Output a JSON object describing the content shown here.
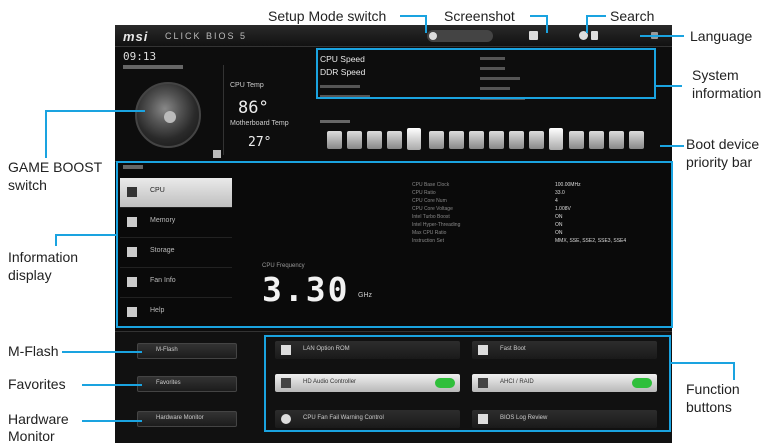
{
  "callouts": {
    "setup_mode_switch": "Setup Mode switch",
    "screenshot": "Screenshot",
    "search": "Search",
    "language": "Language",
    "system_information_line1": "System",
    "system_information_line2": "information",
    "game_boost_line1": "GAME BOOST",
    "game_boost_line2": "switch",
    "boot_device_line1": "Boot device",
    "boot_device_line2": "priority bar",
    "information_display_line1": "Information",
    "information_display_line2": "display",
    "m_flash": "M-Flash",
    "favorites": "Favorites",
    "hardware_monitor_line1": "Hardware",
    "hardware_monitor_line2": "Monitor",
    "function_buttons_line1": "Function",
    "function_buttons_line2": "buttons"
  },
  "bios": {
    "logo": "msi",
    "logo_sub": "CLICK BIOS 5",
    "clock": "09:13",
    "temps": {
      "cpu_label": "CPU Temp",
      "cpu_value": "86°",
      "mb_label": "Motherboard Temp",
      "mb_value": "27°"
    },
    "system_info": {
      "cpu_speed_label": "CPU Speed",
      "ddr_speed_label": "DDR Speed"
    },
    "info_tabs": [
      "CPU",
      "Memory",
      "Storage",
      "Fan Info",
      "Help"
    ],
    "frequency": {
      "label": "CPU Frequency",
      "value": "3.30",
      "unit": "GHz"
    },
    "spec_rows": [
      {
        "k": "CPU Base Clock",
        "v": "100.00MHz"
      },
      {
        "k": "CPU Ratio",
        "v": "33.0"
      },
      {
        "k": "CPU Core Num",
        "v": "4"
      },
      {
        "k": "CPU Core Voltage",
        "v": "1.008V"
      },
      {
        "k": "Intel Turbo Boost",
        "v": "ON"
      },
      {
        "k": "Intel Hyper-Threading",
        "v": "ON"
      },
      {
        "k": "Max CPU Ratio",
        "v": "ON"
      },
      {
        "k": "Instruction Set",
        "v": "MMX, SSE, SSE2, SSE3, SSE4"
      }
    ],
    "left_buttons": [
      "M-Flash",
      "Favorites",
      "Hardware Monitor"
    ],
    "function_buttons": [
      {
        "label": "LAN Option ROM",
        "on": false
      },
      {
        "label": "Fast Boot",
        "on": false
      },
      {
        "label": "HD Audio Controller",
        "on": true
      },
      {
        "label": "AHCI / RAID",
        "on": true
      },
      {
        "label": "CPU Fan Fail Warning Control",
        "on": false
      },
      {
        "label": "BIOS Log Review",
        "on": false
      }
    ]
  }
}
